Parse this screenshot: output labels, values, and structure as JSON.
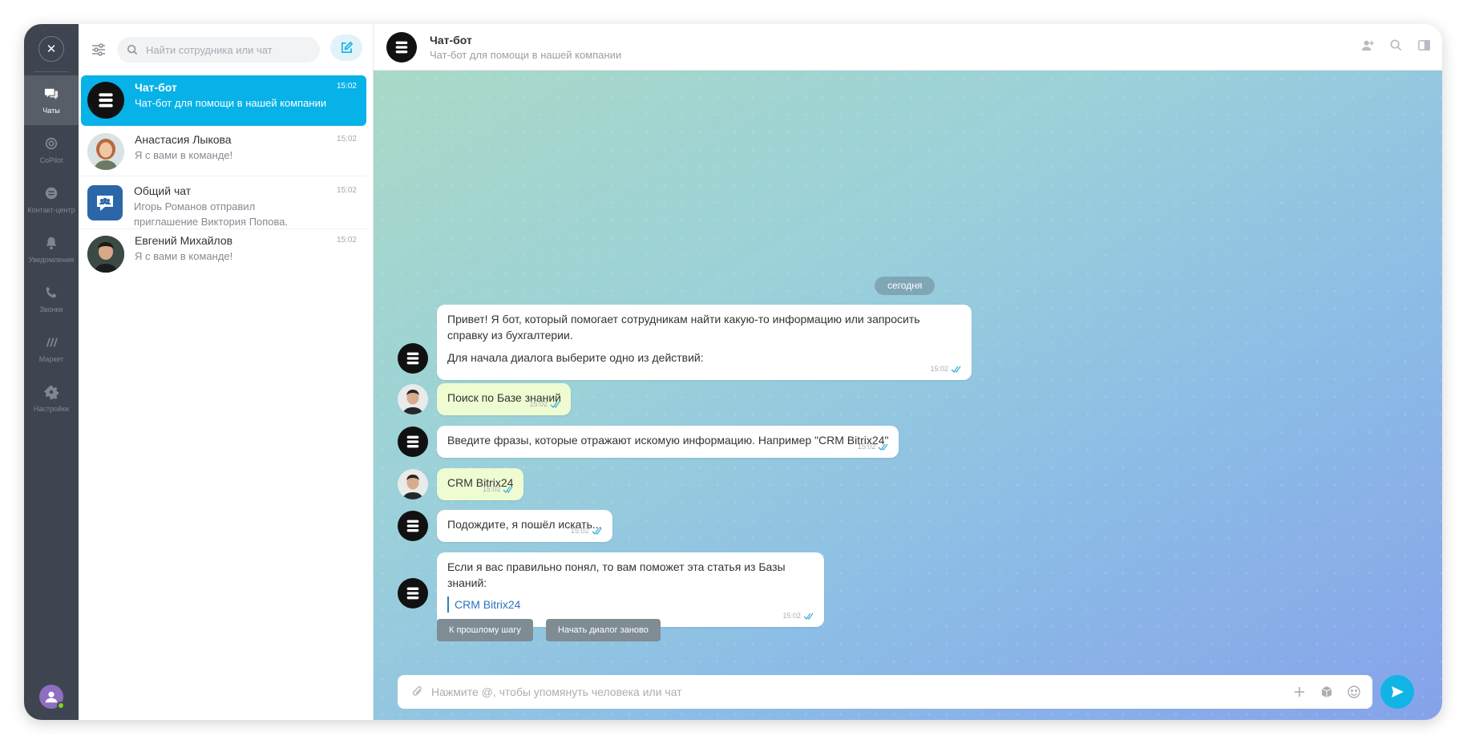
{
  "rail": {
    "close_icon": "close-icon",
    "items": [
      {
        "label": "Чаты",
        "icon": "chats-icon",
        "active": true
      },
      {
        "label": "CoPilot",
        "icon": "copilot-icon"
      },
      {
        "label": "Контакт-центр",
        "icon": "contact-center-icon"
      },
      {
        "label": "Уведомления",
        "icon": "bell-icon"
      },
      {
        "label": "Звонки",
        "icon": "phone-icon"
      },
      {
        "label": "Маркет",
        "icon": "market-icon"
      },
      {
        "label": "Настройки",
        "icon": "gear-icon"
      }
    ]
  },
  "list": {
    "search_placeholder": "Найти сотрудника или чат",
    "chats": [
      {
        "name": "Чат-бот",
        "preview": "Чат-бот для помощи в нашей компании",
        "time": "15:02",
        "active": true
      },
      {
        "name": "Анастасия Лыкова",
        "preview": "Я с вами в команде!",
        "time": "15:02"
      },
      {
        "name": "Общий чат",
        "preview": "Игорь Романов отправил приглашение Виктория Попова.",
        "time": "15:02"
      },
      {
        "name": "Евгений Михайлов",
        "preview": "Я с вами в команде!",
        "time": "15:02"
      }
    ]
  },
  "header": {
    "title": "Чат-бот",
    "subtitle": "Чат-бот для помощи в нашей компании"
  },
  "messages": {
    "date": "сегодня",
    "m1": {
      "p1": "Привет! Я бот, который помогает сотрудникам найти какую-то информацию или запросить справку из бухгалтерии.",
      "p2": "Для начала диалога выберите одно из действий:",
      "time": "15:02"
    },
    "m2": {
      "text": "Поиск по Базе знаний",
      "time": "15:02"
    },
    "m3": {
      "text": "Введите фразы, которые отражают искомую информацию. Например \"CRM Bitrix24\"",
      "time": "15:02"
    },
    "m4": {
      "text": "CRM Bitrix24",
      "time": "15:02"
    },
    "m5": {
      "text": "Подождите, я пошёл искать...",
      "time": "15:02"
    },
    "m6": {
      "text": "Если я вас правильно понял, то вам поможет эта статья из Базы знаний:",
      "link": "CRM Bitrix24",
      "time": "15:02"
    },
    "buttons": {
      "back": "К прошлому шагу",
      "restart": "Начать диалог заново"
    }
  },
  "composer": {
    "placeholder": "Нажмите @, чтобы упомянуть человека или чат"
  },
  "colors": {
    "accent": "#06b2e8",
    "rail": "#3f4550",
    "own_bubble": "#effbd1"
  }
}
